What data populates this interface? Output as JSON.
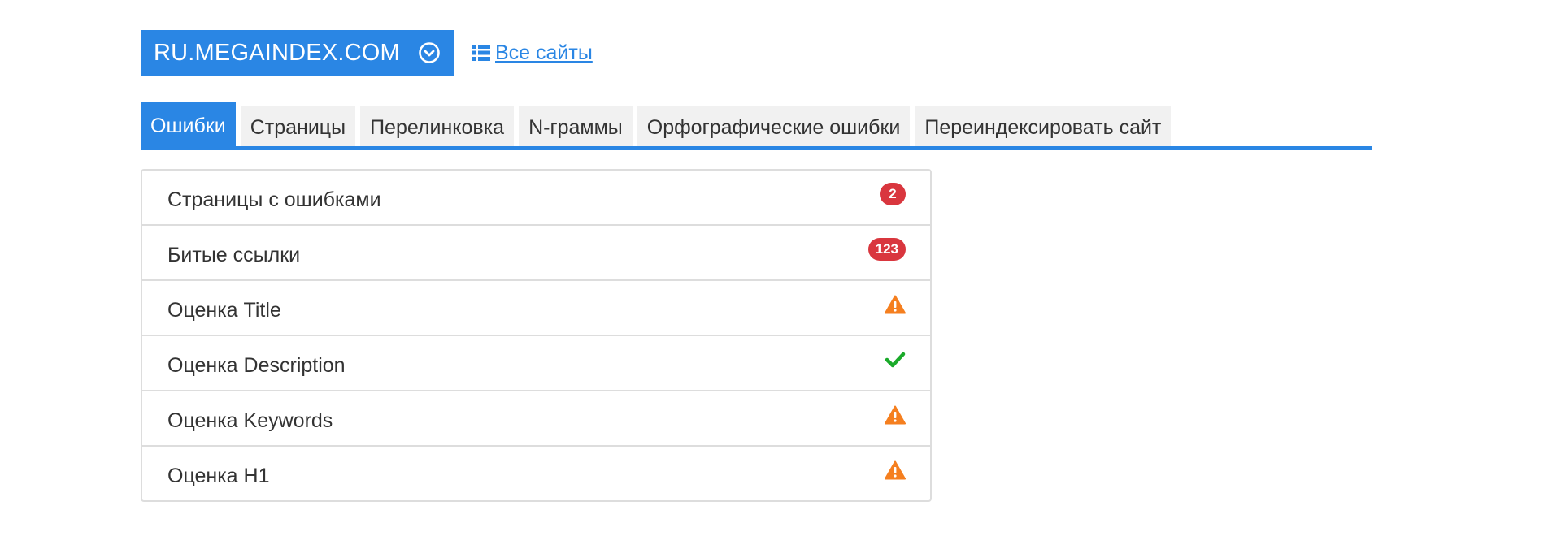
{
  "header": {
    "site_name": "RU.MEGAINDEX.COM",
    "dropdown_icon": "chevron-circle-down-icon",
    "all_sites_label": "Все сайты",
    "all_sites_icon": "list-icon"
  },
  "tabs": [
    {
      "label": "Ошибки",
      "active": true
    },
    {
      "label": "Страницы",
      "active": false
    },
    {
      "label": "Перелинковка",
      "active": false
    },
    {
      "label": "N-граммы",
      "active": false
    },
    {
      "label": "Орфографические ошибки",
      "active": false
    },
    {
      "label": "Переиндексировать сайт",
      "active": false
    }
  ],
  "errors": [
    {
      "label": "Страницы с ошибками",
      "badge": "2",
      "status": "count"
    },
    {
      "label": "Битые ссылки",
      "badge": "123",
      "status": "count"
    },
    {
      "label": "Оценка Title",
      "status": "warning",
      "icon": "warning-icon"
    },
    {
      "label": "Оценка Description",
      "status": "ok",
      "icon": "check-icon"
    },
    {
      "label": "Оценка Keywords",
      "status": "warning",
      "icon": "warning-icon"
    },
    {
      "label": "Оценка H1",
      "status": "warning",
      "icon": "warning-icon"
    }
  ],
  "colors": {
    "accent": "#2a86e4",
    "badge": "#d9363e",
    "warning": "#f57f1f",
    "ok": "#1aaa2a",
    "tab_bg": "#f1f1f1"
  }
}
